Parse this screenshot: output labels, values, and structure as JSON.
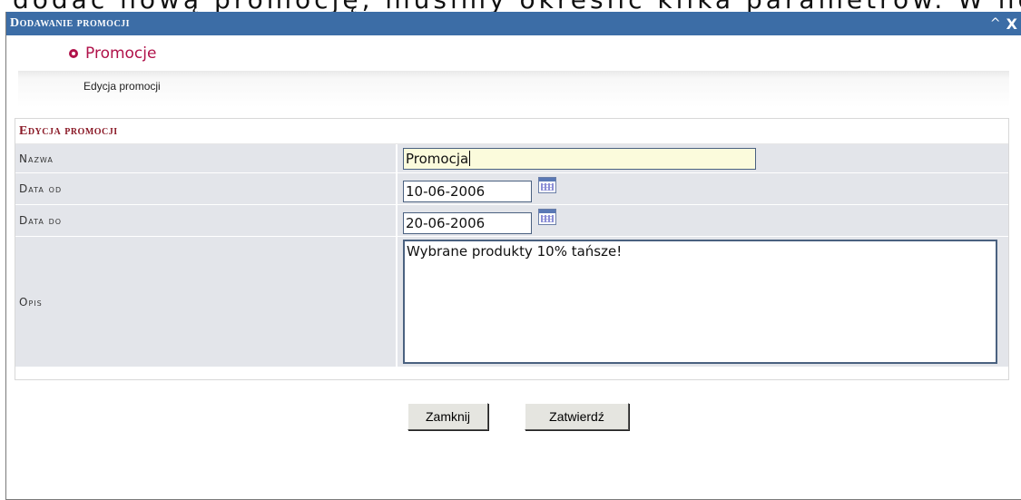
{
  "background_text": "dodać nową promocję, musimy określić kilka parametrów. W nowo ot",
  "dialog": {
    "title": "Dodawanie promocji",
    "controls": {
      "minimize": "^",
      "close": "X"
    }
  },
  "module": {
    "title": "Promocje",
    "subtitle": "Edycja promocji"
  },
  "form": {
    "section_title": "Edycja promocji",
    "fields": {
      "name": {
        "label": "Nazwa",
        "value": "Promocja"
      },
      "date_from": {
        "label": "Data od",
        "value": "10-06-2006"
      },
      "date_to": {
        "label": "Data do",
        "value": "20-06-2006"
      },
      "description": {
        "label": "Opis",
        "value": "Wybrane produkty 10% tańsze!"
      }
    }
  },
  "buttons": {
    "close": "Zamknij",
    "submit": "Zatwierdź"
  },
  "colors": {
    "titlebar": "#3c6da6",
    "accent": "#b0124a",
    "section": "#8b1b28",
    "row_bg": "#e3e5ea",
    "name_field_bg": "#fbfbdc"
  }
}
